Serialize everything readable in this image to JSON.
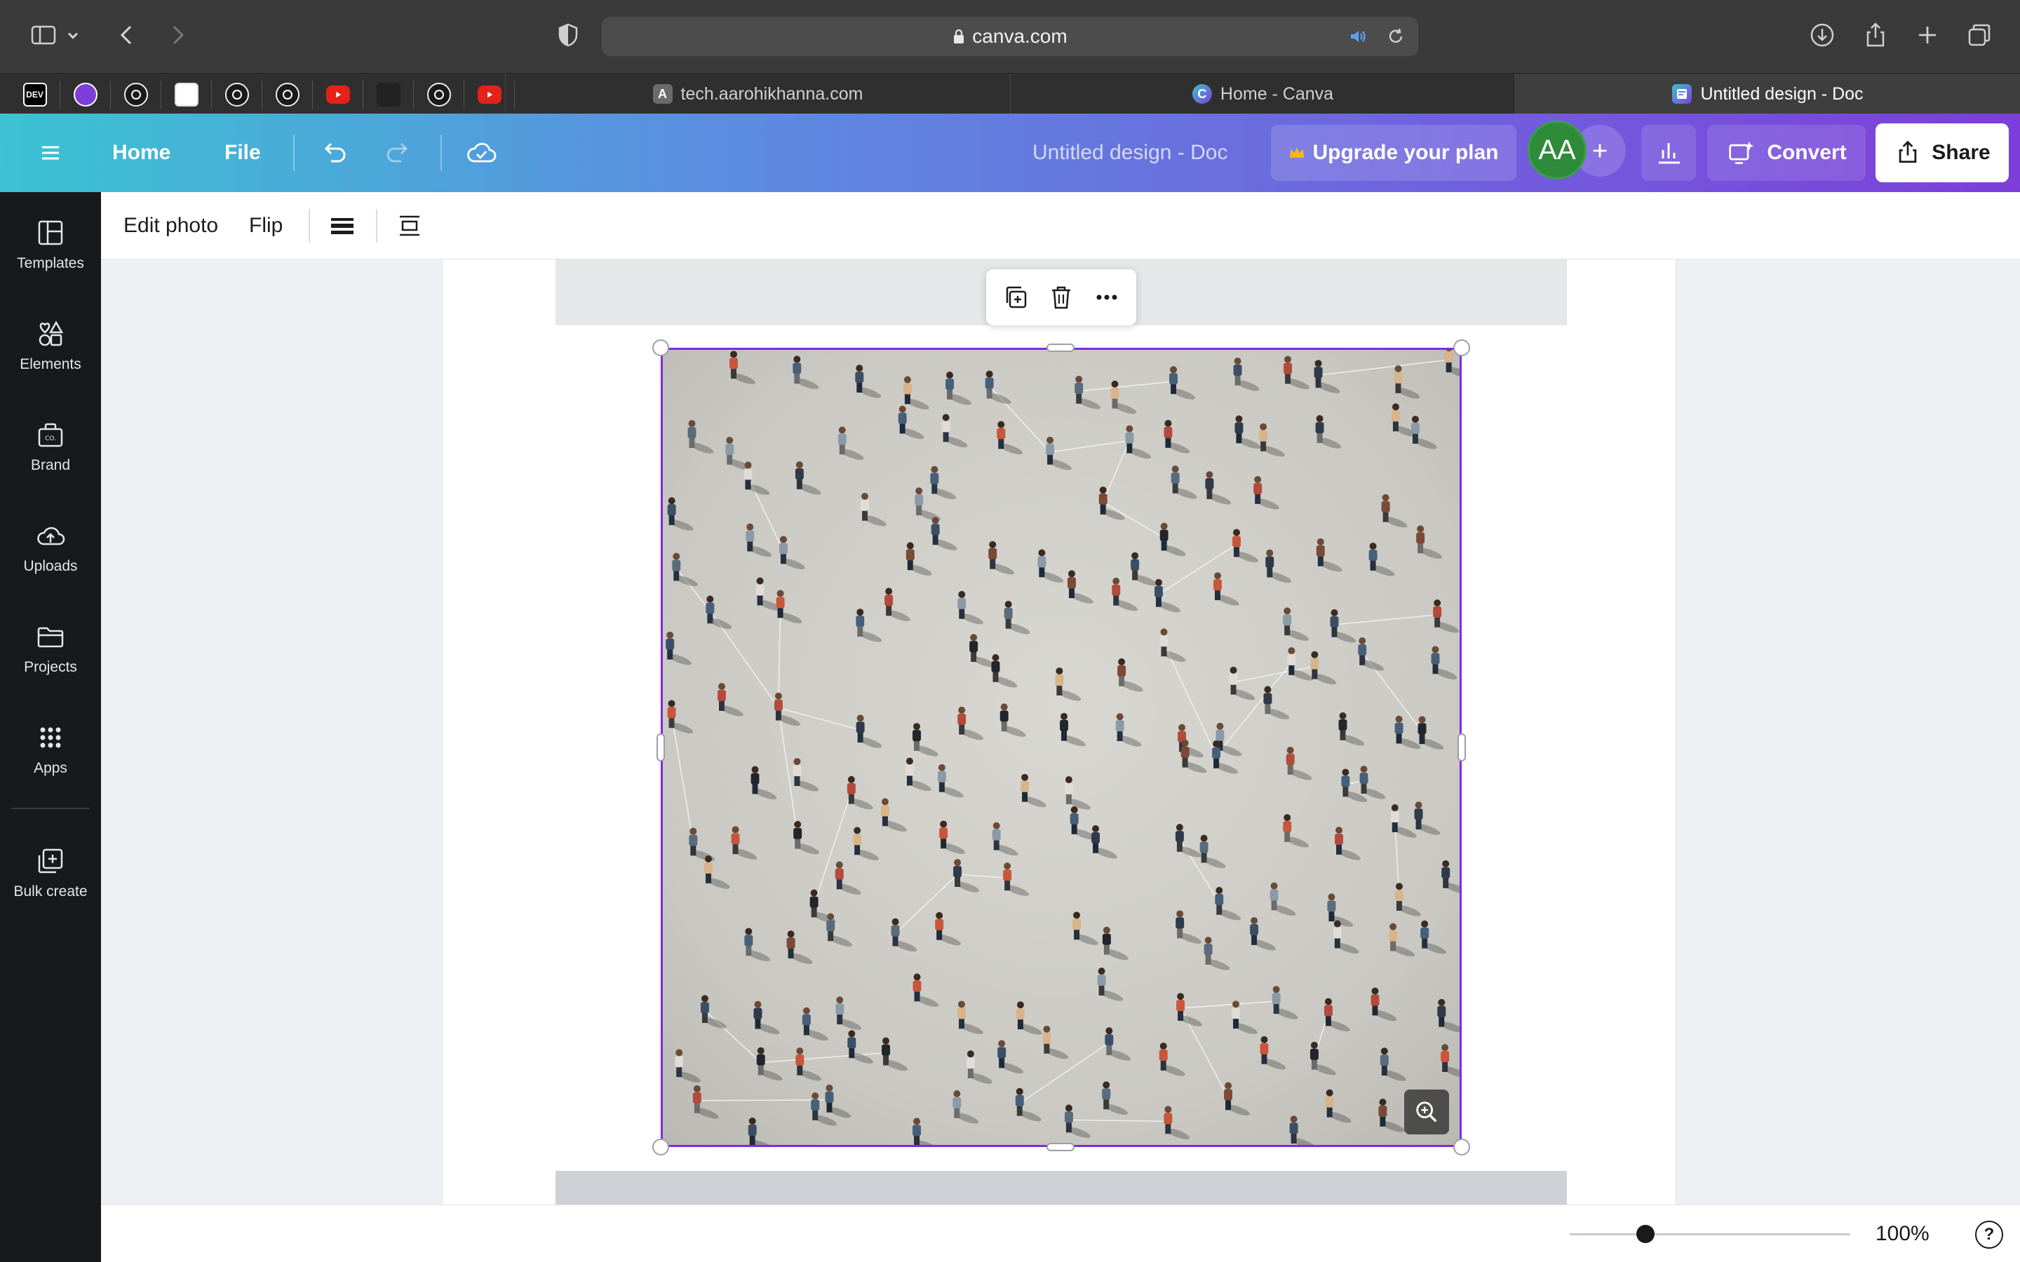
{
  "browser": {
    "url": "canva.com",
    "pinned_tabs": [
      {
        "icon": "dev-icon",
        "text": "DEV",
        "color": "#000000"
      },
      {
        "icon": "canva-pin-icon",
        "text": "",
        "color": "#7d3ed9"
      },
      {
        "icon": "github-icon",
        "text": "",
        "color": "#1a1a1a"
      },
      {
        "icon": "image-icon",
        "text": "",
        "color": "#ffffff"
      },
      {
        "icon": "chatgpt-icon",
        "text": "",
        "color": "#1a1a1a"
      },
      {
        "icon": "github-icon",
        "text": "",
        "color": "#1a1a1a"
      },
      {
        "icon": "youtube-icon",
        "text": "",
        "color": "#e62117"
      },
      {
        "icon": "app-icon",
        "text": "",
        "color": "#222222"
      },
      {
        "icon": "github-icon",
        "text": "",
        "color": "#1a1a1a"
      },
      {
        "icon": "youtube-icon",
        "text": "",
        "color": "#e62117"
      }
    ],
    "tabs": [
      {
        "label": "tech.aarohikhanna.com",
        "favicon": "A"
      },
      {
        "label": "Home - Canva",
        "favicon": "C"
      },
      {
        "label": "Untitled design - Doc",
        "favicon": "doc"
      }
    ]
  },
  "header": {
    "menu_icon": "hamburger-icon",
    "home": "Home",
    "file": "File",
    "doc_title": "Untitled design - Doc",
    "upgrade": "Upgrade your plan",
    "avatar_initials": "AA",
    "convert": "Convert",
    "share": "Share",
    "gradient": [
      "#3bc3d2",
      "#5b8ee0",
      "#6f63de",
      "#7d3ed9"
    ]
  },
  "sidebar": {
    "items": [
      {
        "label": "Templates",
        "icon": "templates-icon"
      },
      {
        "label": "Elements",
        "icon": "elements-icon"
      },
      {
        "label": "Brand",
        "icon": "brand-icon"
      },
      {
        "label": "Uploads",
        "icon": "uploads-icon"
      },
      {
        "label": "Projects",
        "icon": "projects-icon"
      },
      {
        "label": "Apps",
        "icon": "apps-icon"
      },
      {
        "label": "Bulk create",
        "icon": "bulk-create-icon"
      }
    ]
  },
  "toolbar": {
    "edit_photo": "Edit photo",
    "flip": "Flip"
  },
  "canvas": {
    "selection_color": "#7d2ae8"
  },
  "footer": {
    "zoom": "100%",
    "zoom_fraction": 0.27,
    "help": "?"
  }
}
